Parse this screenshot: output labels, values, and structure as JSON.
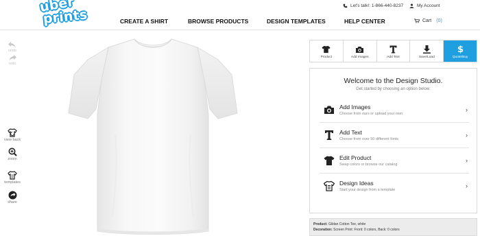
{
  "logo": {
    "line1": "uber",
    "line2": "prints"
  },
  "header": {
    "phone": "Let's talk!: 1-866-440-8237",
    "account": "My Account",
    "nav": [
      "CREATE A SHIRT",
      "BROWSE PRODUCTS",
      "DESIGN TEMPLATES",
      "HELP CENTER"
    ],
    "cart_label": "Cart",
    "cart_count": "(0)"
  },
  "sidebar": {
    "undo": "undo",
    "redo": "redo",
    "view_back": "view back",
    "zoom": "zoom",
    "templates": "templates",
    "share": "share"
  },
  "tabs": [
    "Product",
    "Add Images",
    "Add Text",
    "Save/Load",
    "Quote/Buy"
  ],
  "active_tab": "Quote/Buy",
  "panel": {
    "title": "Welcome to the Design Studio.",
    "subtitle": "Get started by choosing an option below:",
    "options": [
      {
        "title": "Add Images",
        "desc": "Choose from ours or upload your own",
        "icon": "camera-icon"
      },
      {
        "title": "Add Text",
        "desc": "Choose from over 50 different fonts",
        "icon": "text-icon"
      },
      {
        "title": "Edit Product",
        "desc": "Swap colors or browse our catalog",
        "icon": "shirt-icon"
      },
      {
        "title": "Design Ideas",
        "desc": "Start your design from a template",
        "icon": "template-icon"
      }
    ]
  },
  "summary": {
    "product_label": "Product:",
    "product_value": "Gildan Cotton Tee, white",
    "decoration_label": "Decoration:",
    "decoration_value": "Screen Print: Front: 0 colors, Back: 0 colors"
  },
  "colors": {
    "accent": "#1f9fe0",
    "shirt": "#f6f6f6"
  }
}
